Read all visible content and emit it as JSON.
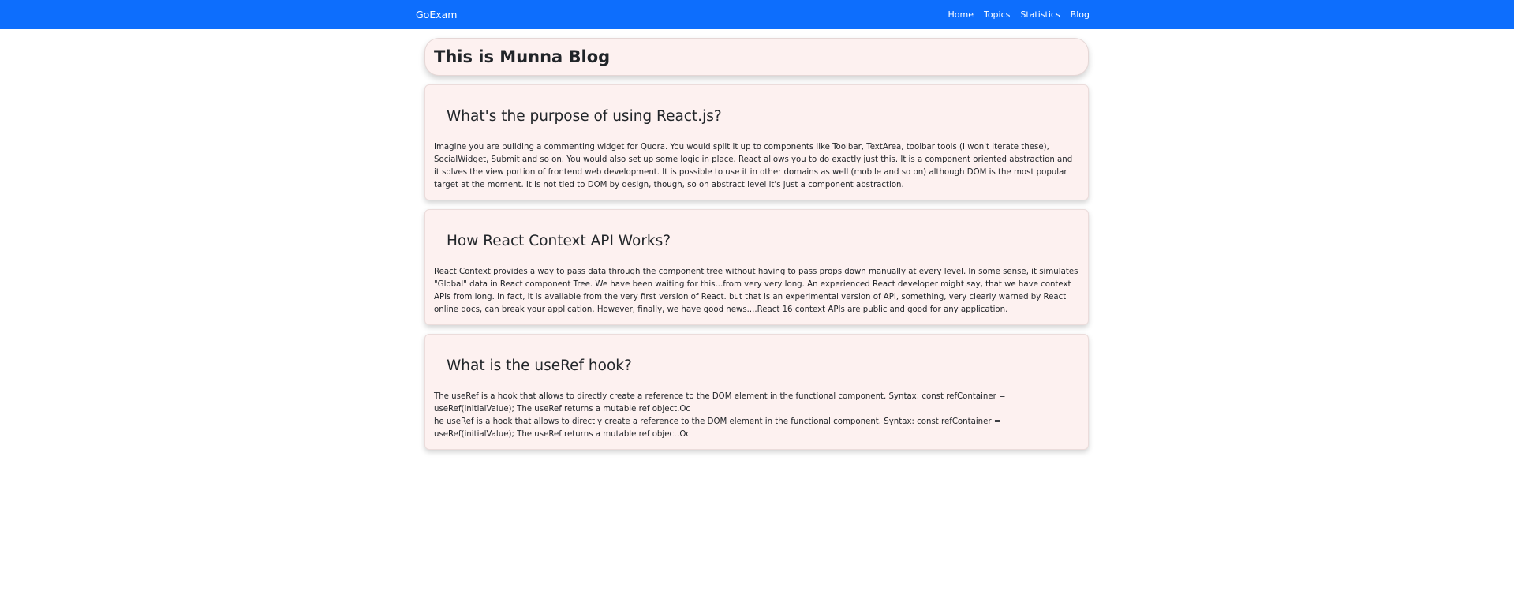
{
  "nav": {
    "brand": "GoExam",
    "links": [
      "Home",
      "Topics",
      "Statistics",
      "Blog"
    ]
  },
  "page": {
    "title": "This is Munna Blog"
  },
  "posts": [
    {
      "question": "What's the purpose of using React.js?",
      "answer": "Imagine you are building a commenting widget for Quora. You would split it up to components like Toolbar, TextArea, toolbar tools (I won't iterate these), SocialWidget, Submit and so on. You would also set up some logic in place. React allows you to do exactly just this. It is a component oriented abstraction and it solves the view portion of frontend web development. It is possible to use it in other domains as well (mobile and so on) although DOM is the most popular target at the moment. It is not tied to DOM by design, though, so on abstract level it's just a component abstraction."
    },
    {
      "question": "How React Context API Works?",
      "answer": "React Context provides a way to pass data through the component tree without having to pass props down manually at every level. In some sense, it simulates \"Global\" data in React component Tree. We have been waiting for this...from very very long. An experienced React developer might say, that we have context APIs from long. In fact, it is available from the very first version of React. but that is an experimental version of API, something, very clearly warned by React online docs, can break your application. However, finally, we have good news....React 16 context APIs are public and good for any application."
    },
    {
      "question": "What is the useRef hook?",
      "answer": "The useRef is a hook that allows to directly create a reference to the DOM element in the functional component. Syntax: const refContainer = useRef(initialValue); The useRef returns a mutable ref object.Oc",
      "answer_extra": "he useRef is a hook that allows to directly create a reference to the DOM element in the functional component. Syntax: const refContainer = useRef(initialValue); The useRef returns a mutable ref object.Oc"
    }
  ],
  "colors": {
    "navbar": "#0d6efd",
    "card_background": "#fdf1f0",
    "text": "#212529"
  }
}
